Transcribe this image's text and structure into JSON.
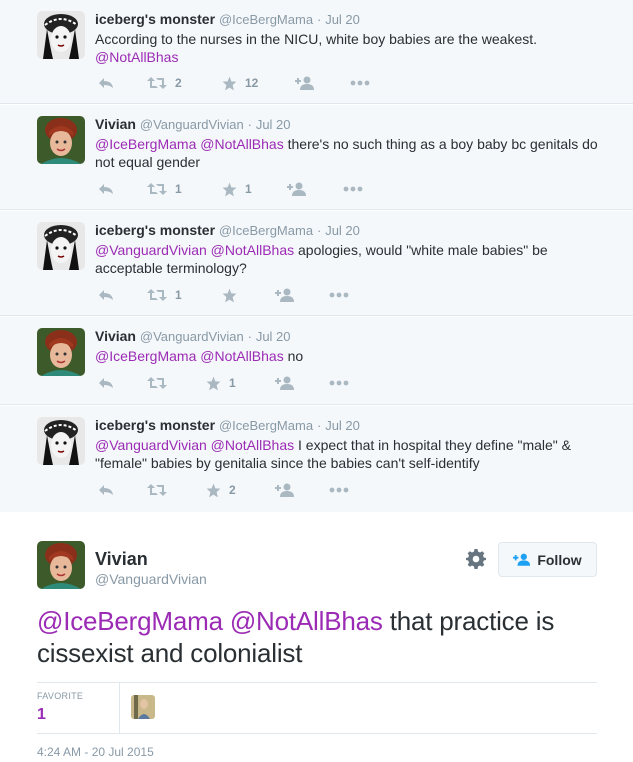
{
  "colors": {
    "link": "#9b2bb5",
    "muted": "#8899a6",
    "text": "#292f33",
    "border": "#e1e8ed"
  },
  "thread": [
    {
      "avatar": "bw-monster-avatar",
      "name": "iceberg's monster",
      "handle": "@IceBergMama",
      "dot": "·",
      "time": "Jul 20",
      "text_plain": "According to the nurses in the NICU, white boy babies are the weakest.",
      "mentions": "@NotAllBhas",
      "retweets": "2",
      "favorites": "12"
    },
    {
      "avatar": "color-vivian-avatar",
      "name": "Vivian",
      "handle": "@VanguardVivian",
      "dot": "·",
      "time": "Jul 20",
      "mentions": "@IceBergMama @NotAllBhas",
      "text_plain": " there's no such thing as a boy baby bc genitals do not equal gender",
      "retweets": "1",
      "favorites": "1"
    },
    {
      "avatar": "bw-monster-avatar",
      "name": "iceberg's monster",
      "handle": "@IceBergMama",
      "dot": "·",
      "time": "Jul 20",
      "mentions": "@VanguardVivian @NotAllBhas",
      "text_plain": " apologies, would \"white male babies\" be acceptable terminology?",
      "retweets": "1",
      "favorites": ""
    },
    {
      "avatar": "color-vivian-avatar",
      "name": "Vivian",
      "handle": "@VanguardVivian",
      "dot": "·",
      "time": "Jul 20",
      "mentions": "@IceBergMama @NotAllBhas",
      "text_plain": " no",
      "retweets": "",
      "favorites": "1"
    },
    {
      "avatar": "bw-monster-avatar",
      "name": "iceberg's monster",
      "handle": "@IceBergMama",
      "dot": "·",
      "time": "Jul 20",
      "mentions": "@VanguardVivian @NotAllBhas",
      "text_plain": " I expect that in hospital they define \"male\" & \"female\" babies by genitalia since the babies can't self-identify",
      "retweets": "",
      "favorites": "2"
    }
  ],
  "main": {
    "name": "Vivian",
    "handle": "@VanguardVivian",
    "follow_label": "Follow",
    "mentions": "@IceBergMama @NotAllBhas",
    "text_plain": " that practice is cissexist and colonialist",
    "stat_label": "FAVORITE",
    "stat_value": "1",
    "timestamp": "4:24 AM - 20 Jul 2015"
  }
}
